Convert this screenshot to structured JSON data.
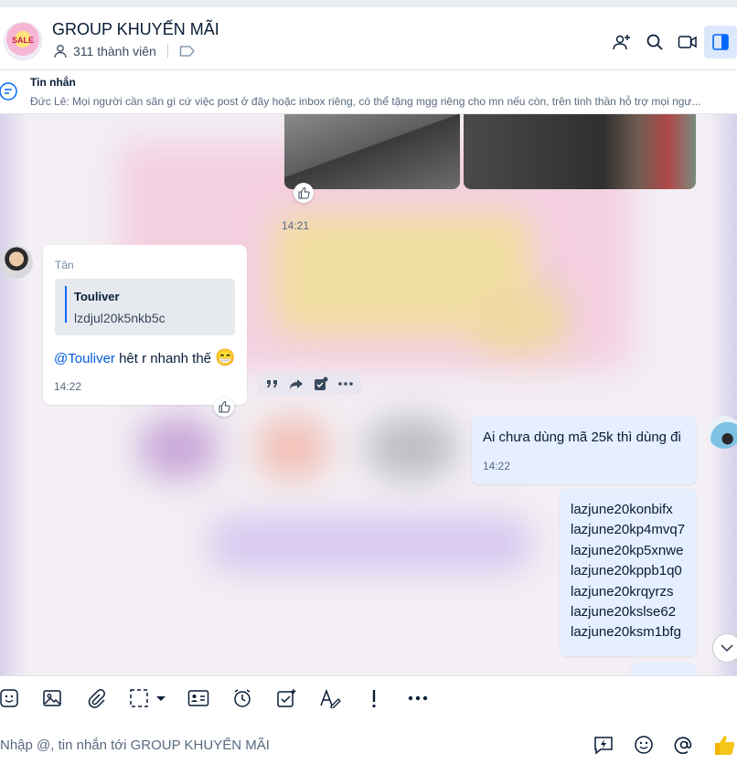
{
  "header": {
    "group_name": "GROUP KHUYẾN MÃI",
    "members": "311 thành viên",
    "avatar_text": "SALE"
  },
  "pinned": {
    "title": "Tin nhắn",
    "text": "Đức Lê: Mọi người cần săn gì cứ việc post ở đây hoặc inbox riêng, có thể tặng mgg riêng cho mn nếu còn, trên tinh thần hỗ trợ mọi ngư..."
  },
  "messages": {
    "image_time": "14:21",
    "tan": {
      "sender": "Tân",
      "quote_name": "Touliver",
      "quote_text": "lzdjul20k5nkb5c",
      "mention": "@Touliver",
      "text": " hêt r nhanh thế ",
      "emoji": "😁",
      "time": "14:22"
    },
    "mine1": {
      "text": "Ai chưa dùng mã 25k thì dùng đi",
      "time": "14:22"
    },
    "codes": [
      "lazjune20konbifx",
      "lazjune20kp4mvq7",
      "lazjune20kp5xnwe",
      "lazjune20kppb1q0",
      "lazjune20krqyrzs",
      "lazjune20kslse62",
      "lazjune20ksm1bfg"
    ]
  },
  "composer": {
    "placeholder": "Nhập @, tin nhắn tới GROUP KHUYẾN MÃI"
  },
  "colors": {
    "accent": "#0068ff",
    "mine_bubble": "#e5efff",
    "chat_bg": "#f3eff4"
  }
}
